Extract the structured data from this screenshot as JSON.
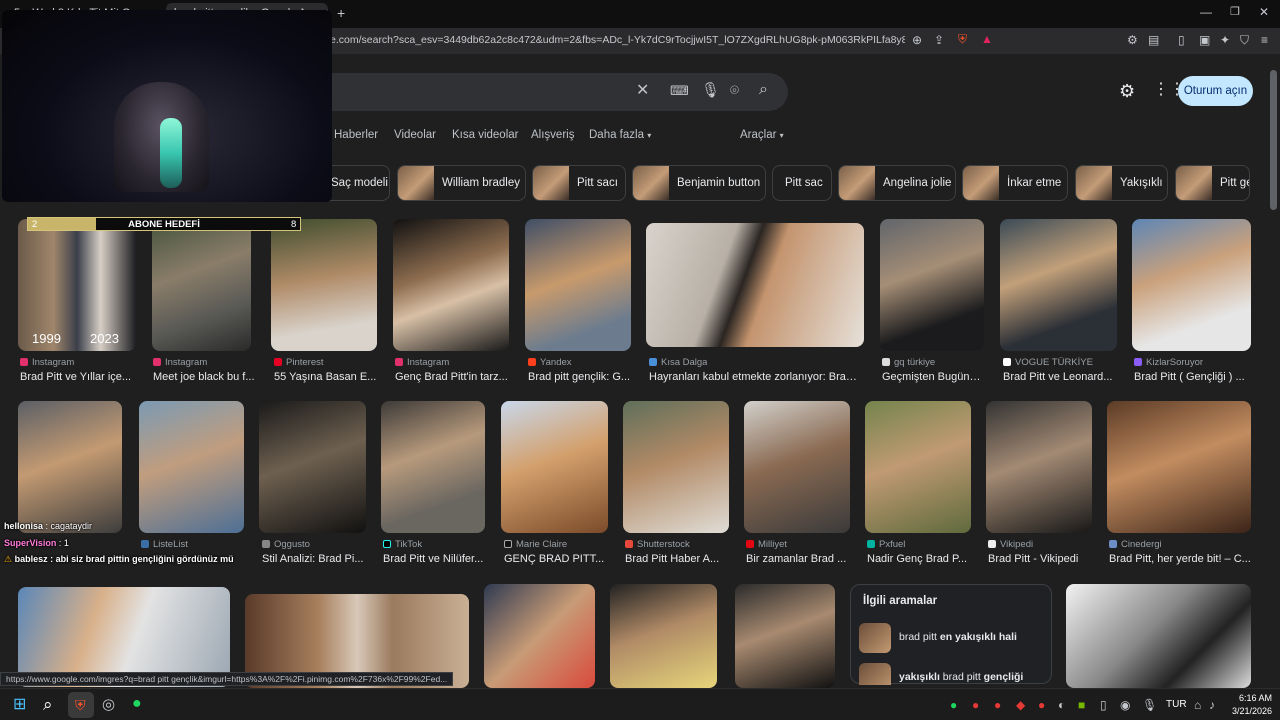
{
  "browser": {
    "tabs": [
      {
        "title": "5... Wed 8 Kde Tit Mit Oe..."
      },
      {
        "title": "brad pitt gençlik - Google Arama"
      }
    ],
    "url": "e.com/search?sca_esv=3449db62a2c8c472&udm=2&fbs=ADc_l-Yk7dC9rTocjjwI5T_lO7ZXgdRLhUG8pk-pM063RkPILfa8y8TDcNYX0oihjHX..."
  },
  "search": {
    "nav_links": [
      "Haberler",
      "Videolar",
      "Kısa videolar",
      "Alışveriş",
      "Daha fazla"
    ],
    "tools_label": "Araçlar",
    "signin_label": "Oturum açın"
  },
  "chips": [
    "Saç modeli",
    "William bradley",
    "Pitt sacı",
    "Benjamin button",
    "Pitt sac",
    "Angelina jolie",
    "İnkar etme",
    "Yakışıklı",
    "Pitt ge"
  ],
  "results_row1": [
    {
      "source": "Instagram",
      "title": "Brad Pitt ve Yıllar içe..."
    },
    {
      "source": "Instagram",
      "title": "Meet joe black bu f..."
    },
    {
      "source": "Pinterest",
      "title": "55 Yaşına Basan E..."
    },
    {
      "source": "Instagram",
      "title": "Genç Brad Pitt'in tarz..."
    },
    {
      "source": "Yandex",
      "title": "Brad pitt gençlik: G..."
    },
    {
      "source": "Kısa Dalga",
      "title": "Hayranları kabul etmekte zorlanıyor: Brad ..."
    },
    {
      "source": "gq türkiye",
      "title": "Geçmişten Bugüne..."
    },
    {
      "source": "VOGUE TÜRKİYE",
      "title": "Brad Pitt ve Leonard..."
    },
    {
      "source": "KizlarSoruyor",
      "title": "Brad Pitt ( Gençliği ) ..."
    }
  ],
  "results_row2": [
    {
      "source": "",
      "title": ""
    },
    {
      "source": "ListeList",
      "title": ""
    },
    {
      "source": "Oggusto",
      "title": "Stil Analizi: Brad Pi..."
    },
    {
      "source": "TikTok",
      "title": "Brad Pitt ve Nilüfer..."
    },
    {
      "source": "Marie Claire",
      "title": "GENÇ BRAD PITT..."
    },
    {
      "source": "Shutterstock",
      "title": "Brad Pitt Haber A..."
    },
    {
      "source": "Milliyet",
      "title": "Bir zamanlar Brad ..."
    },
    {
      "source": "Pxfuel",
      "title": "Nadir Genç Brad P..."
    },
    {
      "source": "Vikipedi",
      "title": "Brad Pitt - Vikipedi"
    },
    {
      "source": "Cinedergi",
      "title": "Brad Pitt, her yerde bit! – C..."
    }
  ],
  "related": {
    "heading": "İlgili aramalar",
    "items": [
      {
        "normal": "brad pitt ",
        "bold": "en yakışıklı hali"
      },
      {
        "bold_prefix": "yakışıklı",
        "normal": " brad pitt ",
        "bold": "gençliği"
      }
    ]
  },
  "overlay": {
    "goal_label": "ABONE HEDEFİ",
    "goal_current": "2",
    "goal_target": "8",
    "goal_fraction": 0.25,
    "year_left": "1999",
    "year_right": "2023",
    "chat": [
      {
        "user": "hellonisa",
        "text": ": cagataydir"
      },
      {
        "user": "SuperVision",
        "text": ": 1"
      },
      {
        "user": "bablesz",
        "text": ": abi siz brad pittin gençliğini gördünüz mü"
      }
    ]
  },
  "status_url": "https://www.google.com/imgres?q=brad pitt gençlik&imgurl=https%3A%2F%2Fi.pinimg.com%2F736x%2F99%2Fed...",
  "taskbar": {
    "lang": "TUR",
    "time": "6:16 AM",
    "date": "3/21/2026"
  }
}
